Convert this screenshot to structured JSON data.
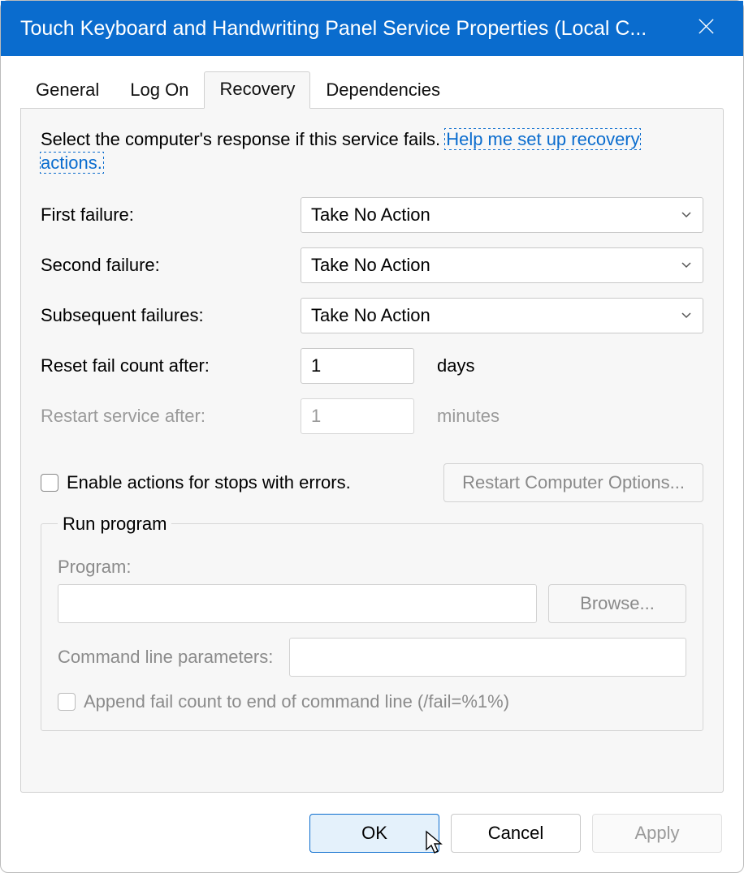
{
  "window": {
    "title": "Touch Keyboard and Handwriting Panel Service Properties (Local C..."
  },
  "tabs": {
    "general": "General",
    "logon": "Log On",
    "recovery": "Recovery",
    "dependencies": "Dependencies"
  },
  "intro": {
    "text": "Select the computer's response if this service fails. ",
    "link": "Help me set up recovery actions."
  },
  "labels": {
    "first_failure": "First failure:",
    "second_failure": "Second failure:",
    "subsequent_failures": "Subsequent failures:",
    "reset_fail_count": "Reset fail count after:",
    "restart_service": "Restart service after:",
    "days": "days",
    "minutes": "minutes",
    "enable_actions": "Enable actions for stops with errors.",
    "restart_options": "Restart Computer Options...",
    "run_program": "Run program",
    "program": "Program:",
    "browse": "Browse...",
    "cmd_params": "Command line parameters:",
    "append_fail": "Append fail count to end of command line (/fail=%1%)"
  },
  "values": {
    "first_failure": "Take No Action",
    "second_failure": "Take No Action",
    "subsequent_failures": "Take No Action",
    "reset_fail_count": "1",
    "restart_service": "1",
    "program": "",
    "cmd_params": ""
  },
  "buttons": {
    "ok": "OK",
    "cancel": "Cancel",
    "apply": "Apply"
  }
}
